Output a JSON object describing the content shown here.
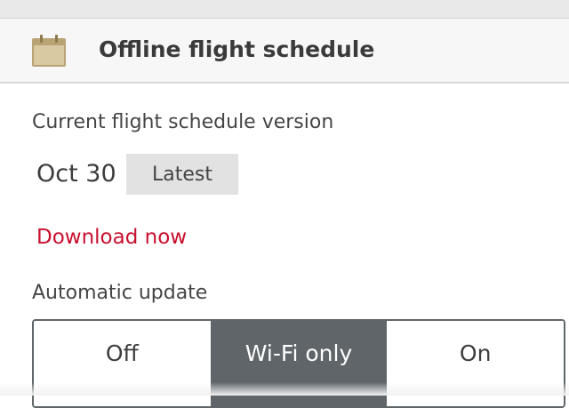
{
  "header": {
    "icon": "calendar-icon",
    "title": "Offline flight schedule"
  },
  "schedule": {
    "label": "Current flight schedule version",
    "version_date": "Oct 30",
    "badge": "Latest",
    "download_label": "Download now"
  },
  "auto_update": {
    "label": "Automatic update",
    "options": [
      "Off",
      "Wi-Fi only",
      "On"
    ],
    "selected": "Wi-Fi only"
  },
  "colors": {
    "accent_red": "#c8102e",
    "selected_segment": "#5f6569",
    "icon_tan": "#c9b68c"
  }
}
